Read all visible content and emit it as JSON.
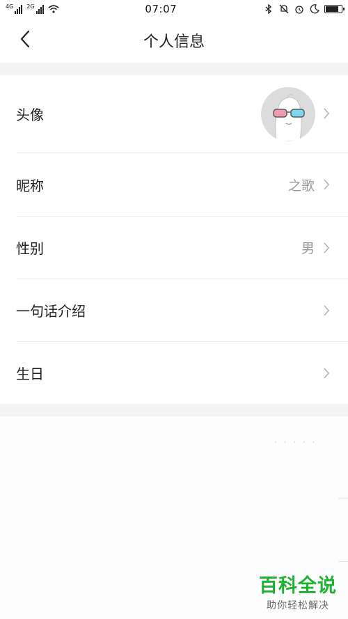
{
  "status_bar": {
    "network1": "4G",
    "network2": "2G",
    "time": "07:07",
    "battery_level": 0.85,
    "icons": [
      "signal-icon",
      "signal-icon",
      "wifi-icon",
      "bluetooth-icon",
      "mute-bell-icon",
      "alarm-icon",
      "moon-icon",
      "battery-icon"
    ]
  },
  "nav": {
    "title": "个人信息",
    "back_icon": "chevron-left-icon"
  },
  "profile": {
    "rows": [
      {
        "label": "头像",
        "value": ""
      },
      {
        "label": "昵称",
        "value": "之歌"
      },
      {
        "label": "性别",
        "value": "男"
      },
      {
        "label": "一句话介绍",
        "value": ""
      },
      {
        "label": "生日",
        "value": ""
      }
    ]
  },
  "lower": {
    "dots": "· · · · ·"
  },
  "watermark": {
    "title": "百科全说",
    "subtitle": "助你轻松解决"
  },
  "colors": {
    "page_bg": "#f4f4f4",
    "card_bg": "#ffffff",
    "value_text": "#999999",
    "watermark_green": "#1fb131"
  }
}
